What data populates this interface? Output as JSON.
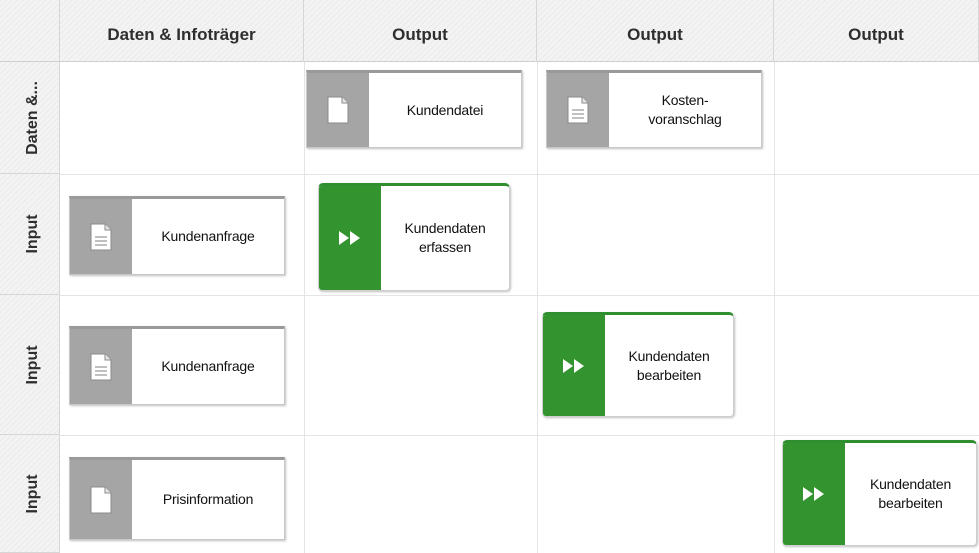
{
  "corner": "",
  "columns": [
    {
      "label": "Daten & Infoträger"
    },
    {
      "label": "Output"
    },
    {
      "label": "Output"
    },
    {
      "label": "Output"
    }
  ],
  "rows": [
    {
      "label": "Daten &..."
    },
    {
      "label": "Input"
    },
    {
      "label": "Input"
    },
    {
      "label": "Input"
    }
  ],
  "nodes": [
    {
      "type": "document",
      "icon": "blank-page-icon",
      "label": "Kundendatei",
      "row": 1,
      "col": 2
    },
    {
      "type": "document",
      "icon": "lined-page-icon",
      "label": "Kosten-\nvoranschlag",
      "row": 1,
      "col": 3
    },
    {
      "type": "document",
      "icon": "lined-page-icon",
      "label": "Kundenanfrage",
      "row": 2,
      "col": 1
    },
    {
      "type": "activity",
      "icon": "fast-forward-icon",
      "label": "Kundendaten\nerfassen",
      "row": 2,
      "col": 2
    },
    {
      "type": "document",
      "icon": "lined-page-icon",
      "label": "Kundenanfrage",
      "row": 3,
      "col": 1
    },
    {
      "type": "activity",
      "icon": "fast-forward-icon",
      "label": "Kundendaten\nbearbeiten",
      "row": 3,
      "col": 3
    },
    {
      "type": "document",
      "icon": "blank-page-icon",
      "label": "Prisinformation",
      "row": 4,
      "col": 1
    },
    {
      "type": "activity",
      "icon": "fast-forward-icon",
      "label": "Kundendaten\nbearbeiten",
      "row": 4,
      "col": 4
    }
  ],
  "colors": {
    "activity": "#33932e",
    "document": "#a5a5a5",
    "grid": "#e4e4e4"
  }
}
